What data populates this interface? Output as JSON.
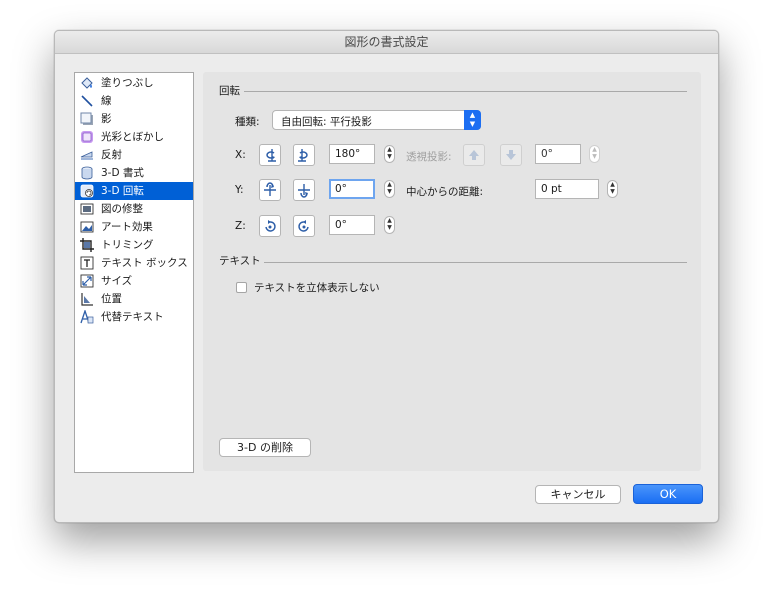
{
  "window": {
    "title": "図形の書式設定"
  },
  "sidebar": {
    "selected_index": 6,
    "items": [
      {
        "label": "塗りつぶし",
        "icon": "paint-bucket-icon"
      },
      {
        "label": "線",
        "icon": "line-icon"
      },
      {
        "label": "影",
        "icon": "shadow-icon"
      },
      {
        "label": "光彩とぼかし",
        "icon": "glow-icon"
      },
      {
        "label": "反射",
        "icon": "reflection-icon"
      },
      {
        "label": "3-D 書式",
        "icon": "3d-format-icon"
      },
      {
        "label": "3-D 回転",
        "icon": "3d-rotation-icon"
      },
      {
        "label": "図の修整",
        "icon": "picture-correction-icon"
      },
      {
        "label": "アート効果",
        "icon": "artistic-effects-icon"
      },
      {
        "label": "トリミング",
        "icon": "crop-icon"
      },
      {
        "label": "テキスト ボックス",
        "icon": "text-box-icon"
      },
      {
        "label": "サイズ",
        "icon": "size-icon"
      },
      {
        "label": "位置",
        "icon": "position-icon"
      },
      {
        "label": "代替テキスト",
        "icon": "alt-text-icon"
      }
    ]
  },
  "rotation": {
    "section_title": "回転",
    "preset_label": "種類:",
    "preset_value": "自由回転: 平行投影",
    "x": {
      "label": "X:",
      "value": "180°"
    },
    "y": {
      "label": "Y:",
      "value": "0°"
    },
    "z": {
      "label": "Z:",
      "value": "0°"
    },
    "perspective": {
      "label": "透視投影:",
      "value": "0°"
    },
    "distance": {
      "label": "中心からの距離:",
      "value": "0 pt"
    }
  },
  "text_section": {
    "title": "テキスト",
    "keep_flat_label": "テキストを立体表示しない"
  },
  "buttons": {
    "clear_3d": "3-D の削除",
    "cancel": "キャンセル",
    "ok": "OK"
  },
  "colors": {
    "accent": "#1a6ef3",
    "selection": "#0060d6"
  }
}
